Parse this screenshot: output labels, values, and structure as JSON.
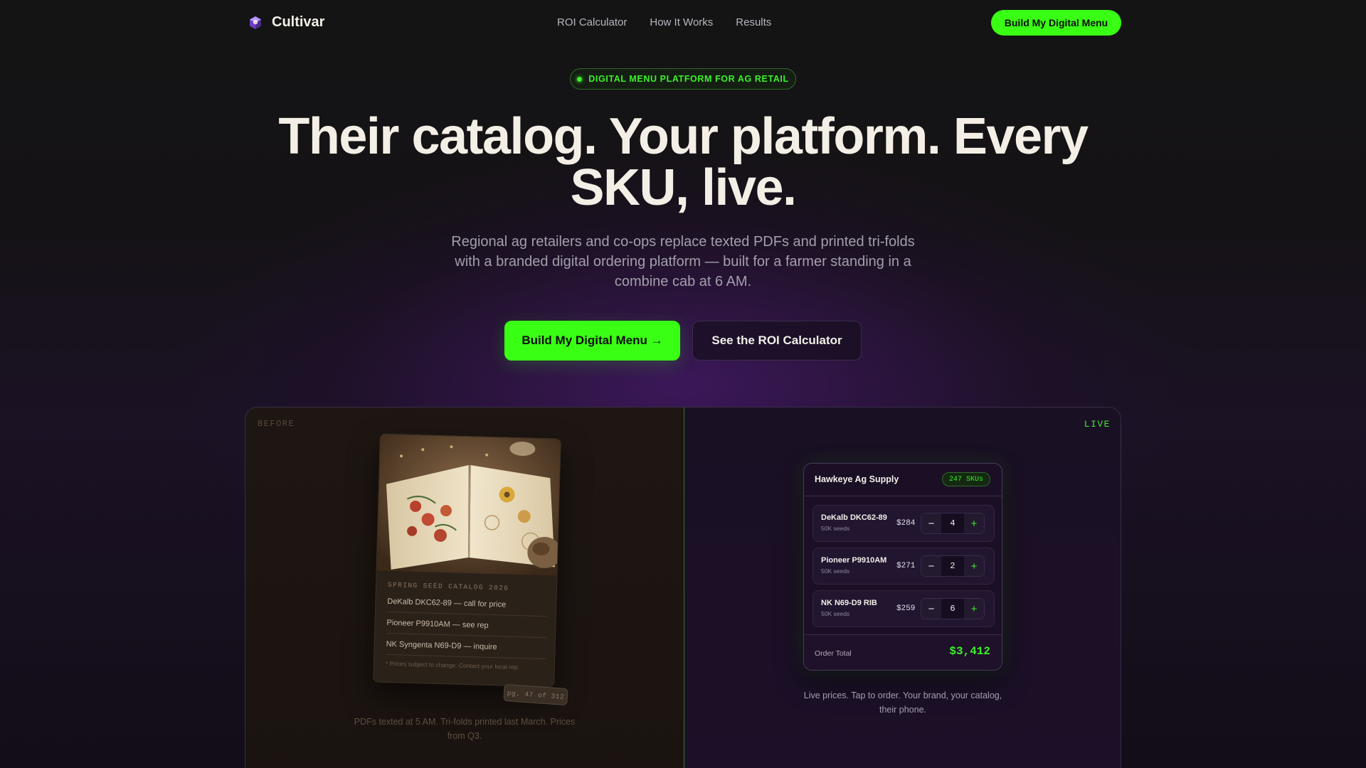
{
  "brand": {
    "name": "Cultivar",
    "logo_icon": "cube-icon"
  },
  "nav": {
    "links": [
      "ROI Calculator",
      "How It Works",
      "Results"
    ],
    "cta": "Build My Digital Menu"
  },
  "hero": {
    "pill": "DIGITAL MENU PLATFORM FOR AG RETAIL",
    "headline": "Their catalog. Your platform. Every SKU, live.",
    "subhead": "Regional ag retailers and co-ops replace texted PDFs and printed tri-folds with a branded digital ordering platform — built for a farmer standing in a combine cab at 6 AM.",
    "primary_cta": "Build My Digital Menu →",
    "secondary_cta": "See the ROI Calculator"
  },
  "before": {
    "tag": "BEFORE",
    "catalog_title": "SPRING SEED CATALOG 2026",
    "lines": [
      "DeKalb DKC62-89 — call for price",
      "Pioneer P9910AM — see rep",
      "NK Syngenta N69-D9 — inquire"
    ],
    "note": "* Prices subject to change. Contact your local rep.",
    "page_badge": "pg. 47 of 312",
    "caption": "PDFs texted at 5 AM. Tri-folds printed last March. Prices from Q3."
  },
  "live": {
    "tag": "LIVE",
    "store": "Hawkeye Ag Supply",
    "sku_count": "247 SKUs",
    "products": [
      {
        "name": "DeKalb DKC62-89",
        "unit": "50K seeds",
        "price": "$284",
        "qty": "4"
      },
      {
        "name": "Pioneer P9910AM",
        "unit": "50K seeds",
        "price": "$271",
        "qty": "2"
      },
      {
        "name": "NK N69-D9 RIB",
        "unit": "50K seeds",
        "price": "$259",
        "qty": "6"
      }
    ],
    "total_label": "Order Total",
    "total_value": "$3,412",
    "caption": "Live prices. Tap to order. Your brand, your catalog, their phone."
  },
  "colors": {
    "accent": "#39ff14",
    "background": "#141414",
    "purple_glow": "#581c87"
  }
}
